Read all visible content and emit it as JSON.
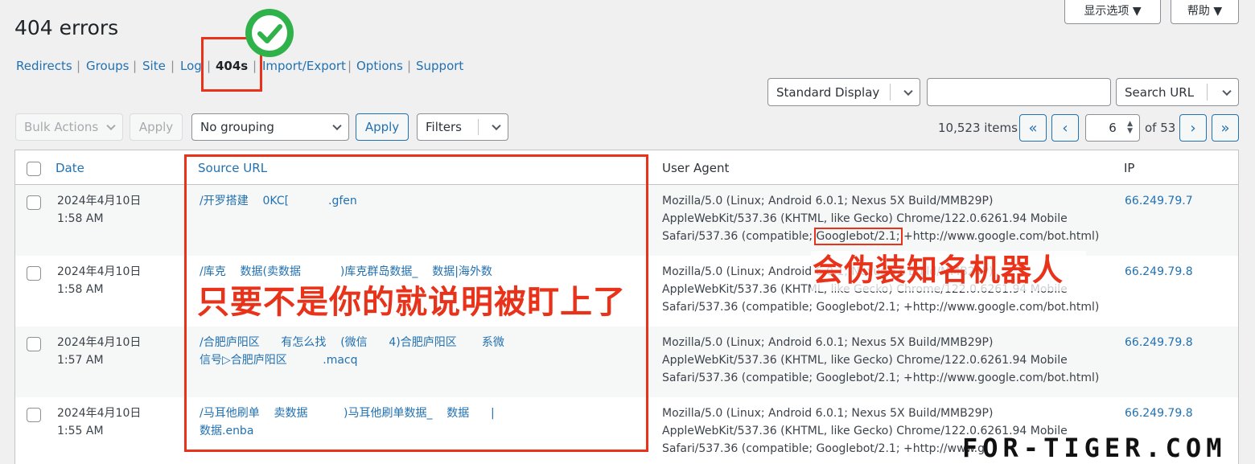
{
  "page_title": "404 errors",
  "screen_options": "显示选项 ▼",
  "help": "帮助 ▼",
  "subnav": [
    "Redirects",
    "Groups",
    "Site",
    "Log",
    "404s",
    "Import/Export",
    "Options",
    "Support"
  ],
  "display_select": "Standard Display",
  "search_value": "",
  "search_button": "Search URL",
  "bulk_actions": "Bulk Actions",
  "apply_disabled": "Apply",
  "grouping": "No grouping",
  "apply": "Apply",
  "filters": "Filters",
  "items_count": "10,523 items",
  "page_first": "«",
  "page_prev": "‹",
  "page_current": "6",
  "page_of": "of 53",
  "page_next": "›",
  "page_last": "»",
  "columns": {
    "date": "Date",
    "source": "Source URL",
    "agent": "User Agent",
    "ip": "IP"
  },
  "rows": [
    {
      "date1": "2024年4月10日",
      "date2": "1:58 AM",
      "src1": "/开罗搭建    0KC[           .gfen",
      "src2": "",
      "ua1": "Mozilla/5.0 (Linux; Android 6.0.1; Nexus 5X Build/MMB29P)",
      "ua2": "AppleWebKit/537.36 (KHTML, like Gecko) Chrome/122.0.6261.94 Mobile",
      "ua3a": "Safari/537.36 (compatible; ",
      "ua3b": "Googlebot/2.1;",
      "ua3c": " +http://www.google.com/bot.html)",
      "ip": "66.249.79.7"
    },
    {
      "date1": "2024年4月10日",
      "date2": "1:58 AM",
      "src1": "/库克    数据(卖数据           )库克群岛数据_    数据|海外数",
      "src2": "",
      "ua1": "Mozilla/5.0 (Linux; Android 6.0.1; Nexus 5X Build/MMB29P)",
      "ua2": "AppleWebKit/537.36 (KHTML, like Gecko) Chrome/122.0.6261.94 Mobile",
      "ua3": "Safari/537.36 (compatible; Googlebot/2.1; +http://www.google.com/bot.html)",
      "ip": "66.249.79.8"
    },
    {
      "date1": "2024年4月10日",
      "date2": "1:57 AM",
      "src1": "/合肥庐阳区      有怎么找    (微信      4)合肥庐阳区       系微",
      "src2": "信号▷合肥庐阳区          .macq",
      "ua1": "Mozilla/5.0 (Linux; Android 6.0.1; Nexus 5X Build/MMB29P)",
      "ua2": "AppleWebKit/537.36 (KHTML, like Gecko) Chrome/122.0.6261.94 Mobile",
      "ua3": "Safari/537.36 (compatible; Googlebot/2.1; +http://www.google.com/bot.html)",
      "ip": "66.249.79.8"
    },
    {
      "date1": "2024年4月10日",
      "date2": "1:55 AM",
      "src1": "/马耳他刷单    卖数据          )马耳他刷单数据_    数据      |",
      "src2": "数据.enba",
      "ua1": "Mozilla/5.0 (Linux; Android 6.0.1; Nexus 5X Build/MMB29P)",
      "ua2": "AppleWebKit/537.36 (KHTML, like Gecko) Chrome/122.0.6261.94 Mobile",
      "ua3": "Safari/537.36 (compatible; Googlebot/2.1; +http://www.g",
      "ip": "66.249.79.8"
    }
  ],
  "annotation_source": "只要不是你的就说明被盯上了",
  "annotation_agent": "会伪装知名机器人",
  "watermark": "FOR-TIGER.COM",
  "colors": {
    "accent": "#2271b1",
    "annotation": "#e8321a",
    "check": "#2fb24a"
  }
}
